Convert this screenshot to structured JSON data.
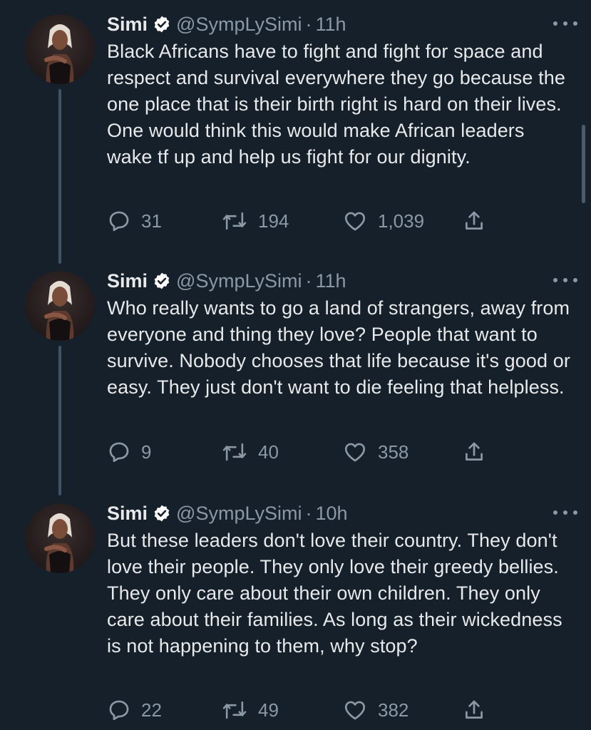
{
  "tweets": [
    {
      "author": "Simi",
      "handle": "@SympLySimi",
      "separator": "·",
      "time": "11h",
      "text": "Black Africans have to fight and fight for space and respect and survival everywhere they go because the one place that is their birth right is hard on their lives. One would think this would make African leaders wake tf up and help us fight for our dignity.",
      "replies": "31",
      "retweets": "194",
      "likes": "1,039"
    },
    {
      "author": "Simi",
      "handle": "@SympLySimi",
      "separator": "·",
      "time": "11h",
      "text": "Who really wants to go a land of strangers, away from everyone and thing they love? People that want to survive. Nobody chooses that life because it's good or easy. They just don't want to die feeling that helpless.",
      "replies": "9",
      "retweets": "40",
      "likes": "358"
    },
    {
      "author": "Simi",
      "handle": "@SympLySimi",
      "separator": "·",
      "time": "10h",
      "text": "But these leaders don't love their country. They don't love their people. They only love their greedy bellies. They only care about their own children. They only care about their families. As long as their wickedness is not happening to them, why stop?",
      "replies": "22",
      "retweets": "49",
      "likes": "382"
    }
  ],
  "colors": {
    "background": "#15202b",
    "text": "#e7e9ea",
    "secondary": "#8b98a5",
    "thread_line": "#3d5466",
    "verified_badge": "#ffffff"
  },
  "icons": {
    "verified": "verified-badge-icon",
    "more": "more-dots-icon",
    "reply": "reply-icon",
    "retweet": "retweet-icon",
    "like": "heart-icon",
    "share": "share-icon"
  }
}
